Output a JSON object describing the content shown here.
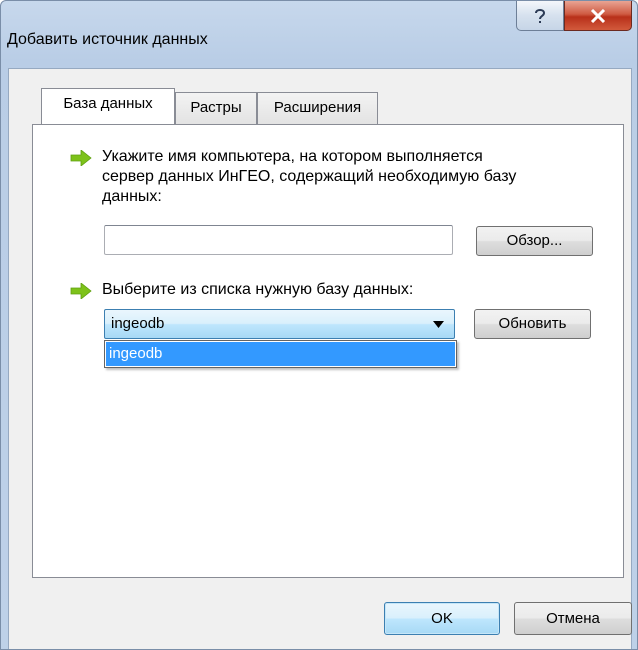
{
  "window": {
    "title": "Добавить источник данных"
  },
  "tabs": [
    {
      "label": "База данных",
      "active": true
    },
    {
      "label": "Растры",
      "active": false
    },
    {
      "label": "Расширения",
      "active": false
    }
  ],
  "step1": {
    "line1": "Укажите имя компьютера, на котором выполняется",
    "line2": "сервер данных ИнГЕО, содержащий необходимую базу",
    "line3": "данных:",
    "input_value": "",
    "browse_label": "Обзор..."
  },
  "step2": {
    "label": "Выберите из списка нужную базу данных:",
    "selected": "ingeodb",
    "options": [
      "ingeodb"
    ],
    "refresh_label": "Обновить"
  },
  "footer": {
    "ok_label": "OK",
    "cancel_label": "Отмена"
  },
  "icons": {
    "step_arrow": "green-arrow-icon",
    "help": "help-icon",
    "close": "close-icon",
    "dropdown": "dropdown-arrow-icon"
  },
  "colors": {
    "arrow": "#7dc21a",
    "selection": "#3399ff",
    "close": "#c9452c"
  }
}
